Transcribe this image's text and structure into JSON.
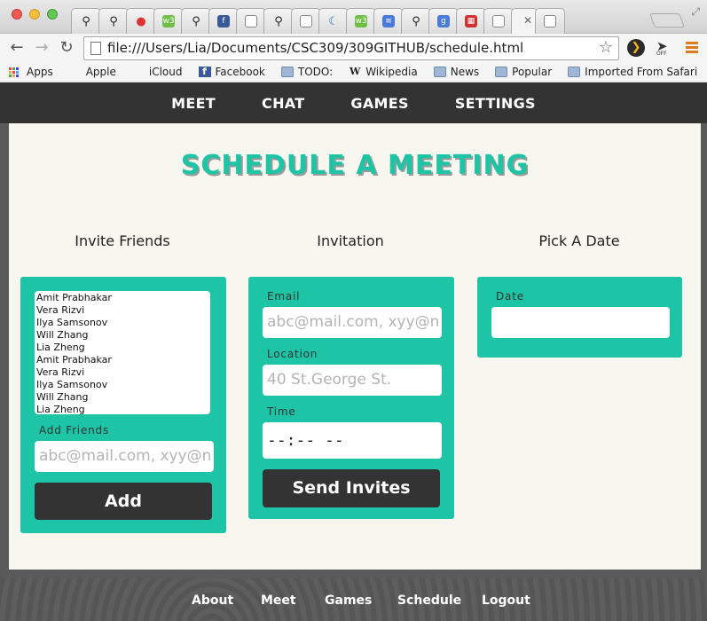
{
  "browser": {
    "url": "file:///Users/Lia/Documents/CSC309/309GITHUB/schedule.html",
    "ext_badge": "OFF",
    "bookmarks": [
      {
        "label": "Apps",
        "icon": "apps-grid-icon"
      },
      {
        "label": "Apple",
        "icon": "apple-icon"
      },
      {
        "label": "iCloud",
        "icon": "apple-icon"
      },
      {
        "label": "Facebook",
        "icon": "facebook-icon"
      },
      {
        "label": "TODO:",
        "icon": "folder-icon"
      },
      {
        "label": "Wikipedia",
        "icon": "wikipedia-icon"
      },
      {
        "label": "News",
        "icon": "folder-icon"
      },
      {
        "label": "Popular",
        "icon": "folder-icon"
      },
      {
        "label": "Imported From Safari",
        "icon": "folder-icon"
      }
    ]
  },
  "site_nav": [
    "MEET",
    "CHAT",
    "GAMES",
    "SETTINGS"
  ],
  "page": {
    "title": "SCHEDULE A MEETING",
    "invite_heading": "Invite Friends",
    "invitation_heading": "Invitation",
    "date_heading": "Pick A Date",
    "friends": [
      "Amit Prabhakar",
      "Vera Rizvi",
      "Ilya Samsonov",
      "Will Zhang",
      "Lia Zheng",
      "Amit Prabhakar",
      "Vera Rizvi",
      "Ilya Samsonov",
      "Will Zhang",
      "Lia Zheng"
    ],
    "add_friends_label": "Add Friends",
    "add_friends_placeholder": "abc@mail.com, xyy@n",
    "add_button": "Add",
    "email_label": "Email",
    "email_placeholder": "abc@mail.com, xyy@n",
    "location_label": "Location",
    "location_placeholder": "40 St.George St.",
    "time_label": "Time",
    "time_value": "--:-- --",
    "send_button": "Send Invites",
    "date_label": "Date",
    "date_value": ""
  },
  "footer": [
    "About",
    "Meet",
    "Games",
    "Schedule",
    "Logout"
  ],
  "colors": {
    "accent": "#1dc4a5",
    "dark": "#333333",
    "background": "#f8f7ef"
  }
}
